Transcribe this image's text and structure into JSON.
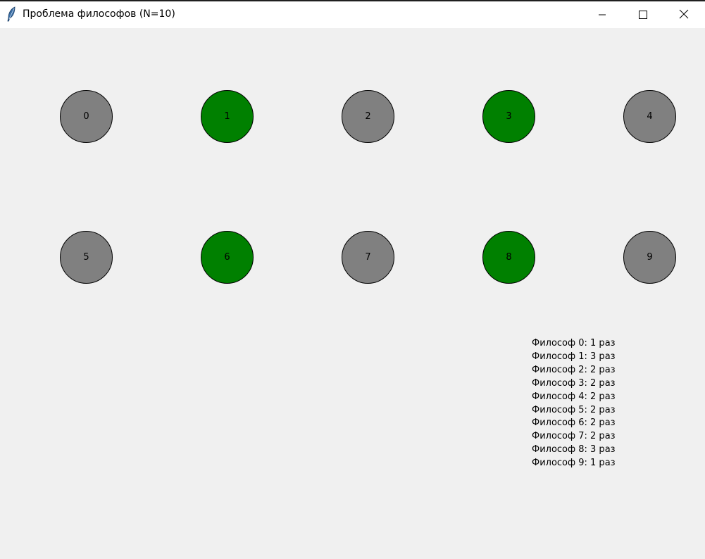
{
  "window": {
    "title": "Проблема философов (N=10)",
    "icon": "feather-icon",
    "controls": [
      "minimize-icon",
      "maximize-icon",
      "close-icon"
    ]
  },
  "colors": {
    "eating": "#008000",
    "thinking": "#808080",
    "background": "#f0f0f0"
  },
  "philosophers": [
    {
      "label": "0",
      "state": "thinking"
    },
    {
      "label": "1",
      "state": "eating"
    },
    {
      "label": "2",
      "state": "thinking"
    },
    {
      "label": "3",
      "state": "eating"
    },
    {
      "label": "4",
      "state": "thinking"
    },
    {
      "label": "5",
      "state": "thinking"
    },
    {
      "label": "6",
      "state": "eating"
    },
    {
      "label": "7",
      "state": "thinking"
    },
    {
      "label": "8",
      "state": "eating"
    },
    {
      "label": "9",
      "state": "thinking"
    }
  ],
  "stats": [
    "Философ 0: 1 раз",
    "Философ 1: 3 раз",
    "Философ 2: 2 раз",
    "Философ 3: 2 раз",
    "Философ 4: 2 раз",
    "Философ 5: 2 раз",
    "Философ 6: 2 раз",
    "Философ 7: 2 раз",
    "Философ 8: 3 раз",
    "Философ 9: 1 раз"
  ]
}
